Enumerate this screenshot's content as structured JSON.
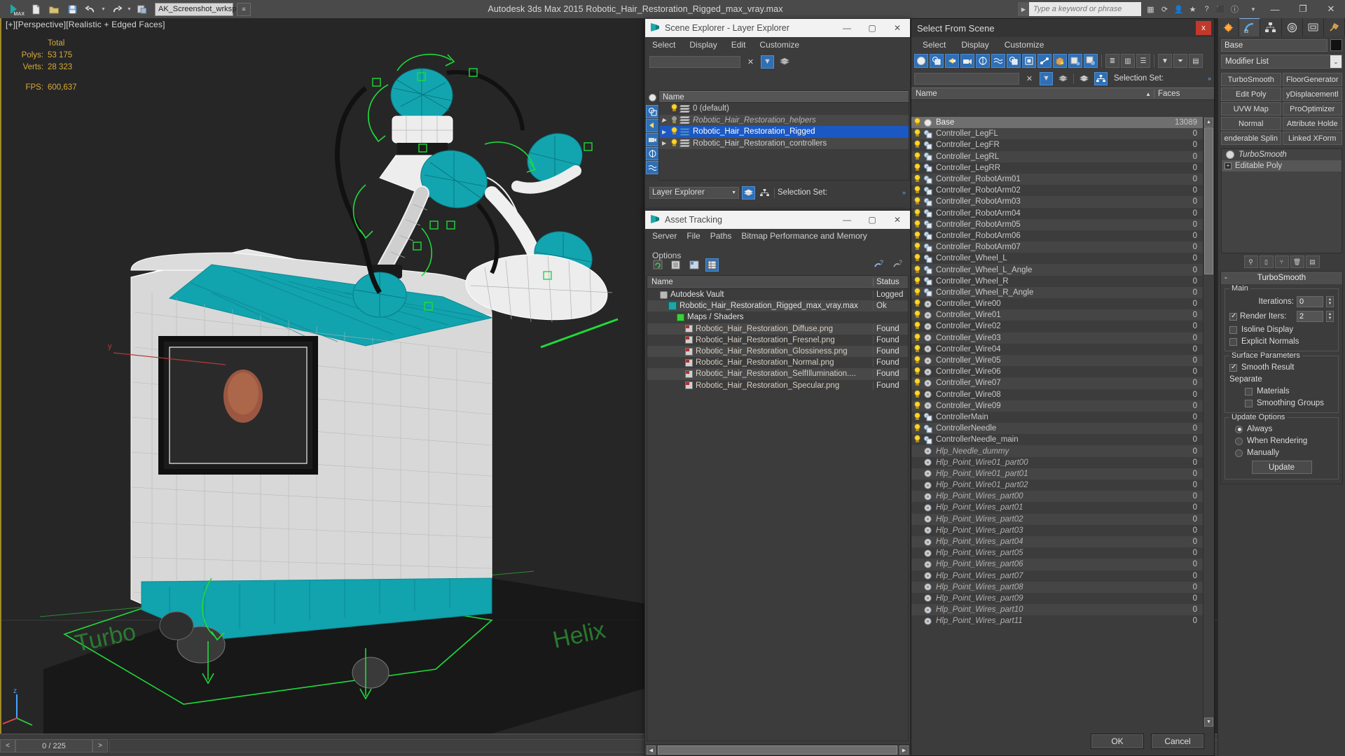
{
  "titlebar": {
    "app_title": "Autodesk 3ds Max  2015    Robotic_Hair_Restoration_Rigged_max_vray.max",
    "workspace": "AK_Screenshot_wrksp",
    "search_placeholder": "Type a keyword or phrase",
    "quick_access": [
      "new-icon",
      "open-icon",
      "save-icon",
      "undo-icon",
      "redo-icon",
      "set-project-icon"
    ],
    "right_icons": [
      "render-setup-icon",
      "render-frame-icon",
      "render-production-icon",
      "help-icon",
      "favorites-icon",
      "info-icon",
      "exchange-icon"
    ],
    "window_buttons": [
      "minimize",
      "maximize",
      "close"
    ]
  },
  "viewport": {
    "label": "[+][Perspective][Realistic + Edged Faces]",
    "stats": {
      "total_header": "Total",
      "polys_label": "Polys:",
      "polys_value": "53 175",
      "verts_label": "Verts:",
      "verts_value": "28 323",
      "fps_label": "FPS:",
      "fps_value": "600,637"
    }
  },
  "timebar": {
    "prev": "<",
    "frame": "0 / 225",
    "next": ">"
  },
  "scene_explorer": {
    "title": "Scene Explorer - Layer Explorer",
    "icon": "max-logo-icon",
    "menus": [
      "Select",
      "Display",
      "Edit",
      "Customize"
    ],
    "search_value": "",
    "column_header": "Name",
    "layers": [
      {
        "name": "0 (default)",
        "bulb": "on",
        "layer_color": "white",
        "expander": false,
        "italic": false,
        "selected": false
      },
      {
        "name": "Robotic_Hair_Restoration_helpers",
        "bulb": "off",
        "layer_color": "white",
        "expander": true,
        "italic": true,
        "selected": false
      },
      {
        "name": "Robotic_Hair_Restoration_Rigged",
        "bulb": "on",
        "layer_color": "blue",
        "expander": true,
        "italic": false,
        "selected": true
      },
      {
        "name": "Robotic_Hair_Restoration_controllers",
        "bulb": "on",
        "layer_color": "white",
        "expander": true,
        "italic": false,
        "selected": false
      }
    ],
    "bottom_dropdown": "Layer Explorer",
    "selection_set_label": "Selection Set:"
  },
  "asset_tracking": {
    "title": "Asset Tracking",
    "icon": "max-logo-icon",
    "menus": [
      "Server",
      "File",
      "Paths",
      "Bitmap Performance and Memory",
      "Options"
    ],
    "toolbar_icons": [
      "refresh-icon",
      "list-view-icon",
      "detail-view-icon",
      "grid-view-icon",
      "add-help-icon",
      "remove-help-icon"
    ],
    "columns": [
      "Name",
      "Status"
    ],
    "rows": [
      {
        "name": "Autodesk Vault",
        "status": "Logged",
        "indent": 1,
        "icon": "vault-icon"
      },
      {
        "name": "Robotic_Hair_Restoration_Rigged_max_vray.max",
        "status": "Ok",
        "indent": 2,
        "icon": "max-file-icon"
      },
      {
        "name": "Maps / Shaders",
        "status": "",
        "indent": 3,
        "icon": "maps-icon"
      },
      {
        "name": "Robotic_Hair_Restoration_Diffuse.png",
        "status": "Found",
        "indent": 4,
        "icon": "png-icon"
      },
      {
        "name": "Robotic_Hair_Restoration_Fresnel.png",
        "status": "Found",
        "indent": 4,
        "icon": "png-icon"
      },
      {
        "name": "Robotic_Hair_Restoration_Glossiness.png",
        "status": "Found",
        "indent": 4,
        "icon": "png-icon"
      },
      {
        "name": "Robotic_Hair_Restoration_Normal.png",
        "status": "Found",
        "indent": 4,
        "icon": "png-icon"
      },
      {
        "name": "Robotic_Hair_Restoration_SelfIllumination....",
        "status": "Found",
        "indent": 4,
        "icon": "png-icon"
      },
      {
        "name": "Robotic_Hair_Restoration_Specular.png",
        "status": "Found",
        "indent": 4,
        "icon": "png-icon"
      }
    ]
  },
  "select_from_scene": {
    "title": "Select From Scene",
    "close_label": "x",
    "menus": [
      "Select",
      "Display",
      "Customize"
    ],
    "search_value": "",
    "selection_set_label": "Selection Set:",
    "columns": {
      "name": "Name",
      "faces": "Faces",
      "sort_arrow": "▲"
    },
    "buttons": {
      "ok": "OK",
      "cancel": "Cancel"
    },
    "rows": [
      {
        "name": "Base",
        "faces": "13089",
        "icon": "geometry-icon",
        "bulb": "on",
        "italic": false,
        "selected": true
      },
      {
        "name": "Controller_LegFL",
        "faces": "0",
        "icon": "shape-icon",
        "bulb": "on",
        "italic": false,
        "selected": false
      },
      {
        "name": "Controller_LegFR",
        "faces": "0",
        "icon": "shape-icon",
        "bulb": "on",
        "italic": false,
        "selected": false
      },
      {
        "name": "Controller_LegRL",
        "faces": "0",
        "icon": "shape-icon",
        "bulb": "on",
        "italic": false,
        "selected": false
      },
      {
        "name": "Controller_LegRR",
        "faces": "0",
        "icon": "shape-icon",
        "bulb": "on",
        "italic": false,
        "selected": false
      },
      {
        "name": "Controller_RobotArm01",
        "faces": "0",
        "icon": "shape-icon",
        "bulb": "on",
        "italic": false,
        "selected": false
      },
      {
        "name": "Controller_RobotArm02",
        "faces": "0",
        "icon": "shape-icon",
        "bulb": "on",
        "italic": false,
        "selected": false
      },
      {
        "name": "Controller_RobotArm03",
        "faces": "0",
        "icon": "shape-icon",
        "bulb": "on",
        "italic": false,
        "selected": false
      },
      {
        "name": "Controller_RobotArm04",
        "faces": "0",
        "icon": "shape-icon",
        "bulb": "on",
        "italic": false,
        "selected": false
      },
      {
        "name": "Controller_RobotArm05",
        "faces": "0",
        "icon": "shape-icon",
        "bulb": "on",
        "italic": false,
        "selected": false
      },
      {
        "name": "Controller_RobotArm06",
        "faces": "0",
        "icon": "shape-icon",
        "bulb": "on",
        "italic": false,
        "selected": false
      },
      {
        "name": "Controller_RobotArm07",
        "faces": "0",
        "icon": "shape-icon",
        "bulb": "on",
        "italic": false,
        "selected": false
      },
      {
        "name": "Controller_Wheel_L",
        "faces": "0",
        "icon": "shape-icon",
        "bulb": "on",
        "italic": false,
        "selected": false
      },
      {
        "name": "Controller_Wheel_L_Angle",
        "faces": "0",
        "icon": "shape-icon",
        "bulb": "on",
        "italic": false,
        "selected": false
      },
      {
        "name": "Controller_Wheel_R",
        "faces": "0",
        "icon": "shape-icon",
        "bulb": "on",
        "italic": false,
        "selected": false
      },
      {
        "name": "Controller_Wheel_R_Angle",
        "faces": "0",
        "icon": "shape-icon",
        "bulb": "on",
        "italic": false,
        "selected": false
      },
      {
        "name": "Controller_Wire00",
        "faces": "0",
        "icon": "helper-icon",
        "bulb": "on",
        "italic": false,
        "selected": false
      },
      {
        "name": "Controller_Wire01",
        "faces": "0",
        "icon": "helper-icon",
        "bulb": "on",
        "italic": false,
        "selected": false
      },
      {
        "name": "Controller_Wire02",
        "faces": "0",
        "icon": "helper-icon",
        "bulb": "on",
        "italic": false,
        "selected": false
      },
      {
        "name": "Controller_Wire03",
        "faces": "0",
        "icon": "helper-icon",
        "bulb": "on",
        "italic": false,
        "selected": false
      },
      {
        "name": "Controller_Wire04",
        "faces": "0",
        "icon": "helper-icon",
        "bulb": "on",
        "italic": false,
        "selected": false
      },
      {
        "name": "Controller_Wire05",
        "faces": "0",
        "icon": "helper-icon",
        "bulb": "on",
        "italic": false,
        "selected": false
      },
      {
        "name": "Controller_Wire06",
        "faces": "0",
        "icon": "helper-icon",
        "bulb": "on",
        "italic": false,
        "selected": false
      },
      {
        "name": "Controller_Wire07",
        "faces": "0",
        "icon": "helper-icon",
        "bulb": "on",
        "italic": false,
        "selected": false
      },
      {
        "name": "Controller_Wire08",
        "faces": "0",
        "icon": "helper-icon",
        "bulb": "on",
        "italic": false,
        "selected": false
      },
      {
        "name": "Controller_Wire09",
        "faces": "0",
        "icon": "helper-icon",
        "bulb": "on",
        "italic": false,
        "selected": false
      },
      {
        "name": "ControllerMain",
        "faces": "0",
        "icon": "shape-icon",
        "bulb": "on",
        "italic": false,
        "selected": false
      },
      {
        "name": "ControllerNeedle",
        "faces": "0",
        "icon": "shape-icon",
        "bulb": "on",
        "italic": false,
        "selected": false
      },
      {
        "name": "ControllerNeedle_main",
        "faces": "0",
        "icon": "shape-icon",
        "bulb": "on",
        "italic": false,
        "selected": false
      },
      {
        "name": "Hlp_Needle_dummy",
        "faces": "0",
        "icon": "helper-icon",
        "bulb": "hidden",
        "italic": true,
        "selected": false
      },
      {
        "name": "Hlp_Point_Wire01_part00",
        "faces": "0",
        "icon": "helper-icon",
        "bulb": "hidden",
        "italic": true,
        "selected": false
      },
      {
        "name": "Hlp_Point_Wire01_part01",
        "faces": "0",
        "icon": "helper-icon",
        "bulb": "hidden",
        "italic": true,
        "selected": false
      },
      {
        "name": "Hlp_Point_Wire01_part02",
        "faces": "0",
        "icon": "helper-icon",
        "bulb": "hidden",
        "italic": true,
        "selected": false
      },
      {
        "name": "Hlp_Point_Wires_part00",
        "faces": "0",
        "icon": "helper-icon",
        "bulb": "hidden",
        "italic": true,
        "selected": false
      },
      {
        "name": "Hlp_Point_Wires_part01",
        "faces": "0",
        "icon": "helper-icon",
        "bulb": "hidden",
        "italic": true,
        "selected": false
      },
      {
        "name": "Hlp_Point_Wires_part02",
        "faces": "0",
        "icon": "helper-icon",
        "bulb": "hidden",
        "italic": true,
        "selected": false
      },
      {
        "name": "Hlp_Point_Wires_part03",
        "faces": "0",
        "icon": "helper-icon",
        "bulb": "hidden",
        "italic": true,
        "selected": false
      },
      {
        "name": "Hlp_Point_Wires_part04",
        "faces": "0",
        "icon": "helper-icon",
        "bulb": "hidden",
        "italic": true,
        "selected": false
      },
      {
        "name": "Hlp_Point_Wires_part05",
        "faces": "0",
        "icon": "helper-icon",
        "bulb": "hidden",
        "italic": true,
        "selected": false
      },
      {
        "name": "Hlp_Point_Wires_part06",
        "faces": "0",
        "icon": "helper-icon",
        "bulb": "hidden",
        "italic": true,
        "selected": false
      },
      {
        "name": "Hlp_Point_Wires_part07",
        "faces": "0",
        "icon": "helper-icon",
        "bulb": "hidden",
        "italic": true,
        "selected": false
      },
      {
        "name": "Hlp_Point_Wires_part08",
        "faces": "0",
        "icon": "helper-icon",
        "bulb": "hidden",
        "italic": true,
        "selected": false
      },
      {
        "name": "Hlp_Point_Wires_part09",
        "faces": "0",
        "icon": "helper-icon",
        "bulb": "hidden",
        "italic": true,
        "selected": false
      },
      {
        "name": "Hlp_Point_Wires_part10",
        "faces": "0",
        "icon": "helper-icon",
        "bulb": "hidden",
        "italic": true,
        "selected": false
      },
      {
        "name": "Hlp_Point_Wires_part11",
        "faces": "0",
        "icon": "helper-icon",
        "bulb": "hidden",
        "italic": true,
        "selected": false
      }
    ]
  },
  "command_panel": {
    "tabs": [
      "create-tab",
      "modify-tab",
      "hierarchy-tab",
      "motion-tab",
      "display-tab",
      "utilities-tab"
    ],
    "active_tab_index": 1,
    "object_name": "Base",
    "modifier_list_label": "Modifier List",
    "modifier_buttons": [
      "TurboSmooth",
      "FloorGenerator",
      "Edit Poly",
      "yDisplacementl",
      "UVW Map",
      "ProOptimizer",
      "Normal",
      "Attribute Holde",
      "enderable Splin",
      "Linked XForm"
    ],
    "stack": [
      {
        "label": "TurboSmooth",
        "italic": true,
        "active": false
      },
      {
        "label": "Editable Poly",
        "italic": false,
        "active": true
      }
    ],
    "turbosmooth": {
      "title": "TurboSmooth",
      "minimize_glyph": "-",
      "groups": {
        "main": {
          "title": "Main",
          "iterations_label": "Iterations:",
          "iterations_value": "0",
          "render_iters_label": "Render Iters:",
          "render_iters_value": "2",
          "render_iters_checked": true,
          "isoline_display_label": "Isoline Display",
          "isoline_display_checked": false,
          "explicit_normals_label": "Explicit Normals",
          "explicit_normals_checked": false
        },
        "surface": {
          "title": "Surface Parameters",
          "smooth_result_label": "Smooth Result",
          "smooth_result_checked": true,
          "separate_label": "Separate",
          "materials_label": "Materials",
          "materials_checked": false,
          "smoothing_groups_label": "Smoothing Groups",
          "smoothing_groups_checked": false
        },
        "update": {
          "title": "Update Options",
          "options": [
            "Always",
            "When Rendering",
            "Manually"
          ],
          "selected_index": 0,
          "update_button": "Update"
        }
      }
    }
  }
}
